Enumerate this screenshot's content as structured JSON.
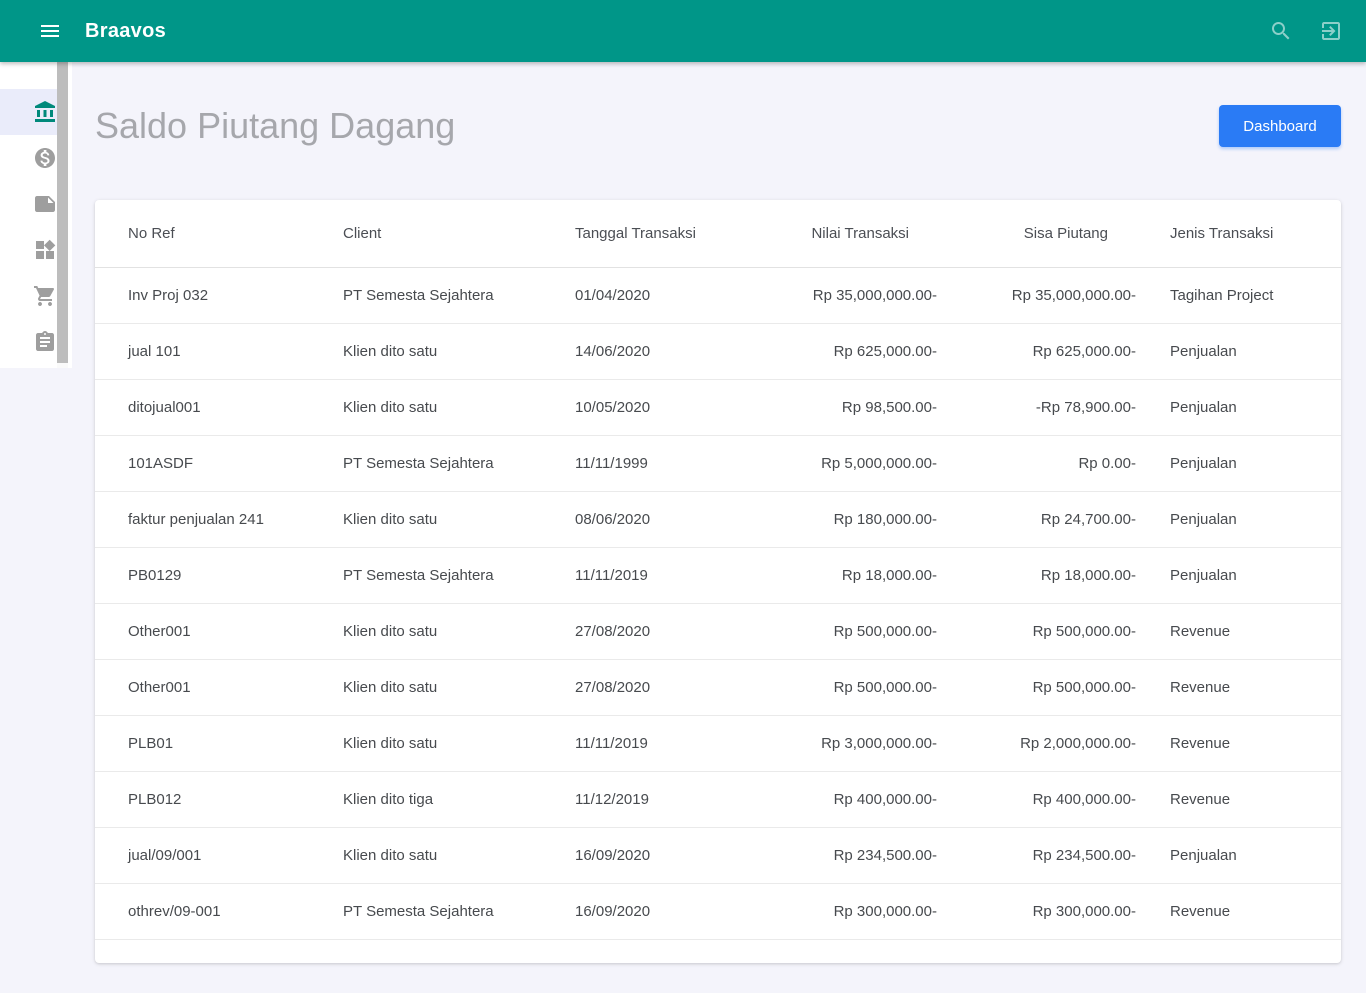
{
  "app": {
    "title": "Braavos",
    "brand_color": "#009688",
    "header_icons": [
      "menu-icon",
      "search-icon",
      "exit-icon"
    ]
  },
  "sidebar": {
    "active_icon_color": "#00897b",
    "inactive_icon_color": "#9e9e9e",
    "items": [
      {
        "icon": "bank-icon",
        "active": true
      },
      {
        "icon": "money-icon",
        "active": false
      },
      {
        "icon": "note-icon",
        "active": false
      },
      {
        "icon": "widgets-icon",
        "active": false
      },
      {
        "icon": "cart-icon",
        "active": false
      },
      {
        "icon": "clipboard-icon",
        "active": false
      }
    ]
  },
  "page": {
    "title": "Saldo Piutang Dagang",
    "dashboard_button": "Dashboard",
    "button_color": "#2a7bf5"
  },
  "table": {
    "columns": [
      "No Ref",
      "Client",
      "Tanggal Transaksi",
      "Nilai Transaksi",
      "Sisa Piutang",
      "Jenis Transaksi"
    ],
    "rows": [
      [
        "Inv Proj 032",
        "PT Semesta Sejahtera",
        "01/04/2020",
        "Rp 35,000,000.00-",
        "Rp 35,000,000.00-",
        "Tagihan Project"
      ],
      [
        "jual 101",
        "Klien dito satu",
        "14/06/2020",
        "Rp 625,000.00-",
        "Rp 625,000.00-",
        "Penjualan"
      ],
      [
        "ditojual001",
        "Klien dito satu",
        "10/05/2020",
        "Rp 98,500.00-",
        "-Rp 78,900.00-",
        "Penjualan"
      ],
      [
        "101ASDF",
        "PT Semesta Sejahtera",
        "11/11/1999",
        "Rp 5,000,000.00-",
        "Rp 0.00-",
        "Penjualan"
      ],
      [
        "faktur penjualan 241",
        "Klien dito satu",
        "08/06/2020",
        "Rp 180,000.00-",
        "Rp 24,700.00-",
        "Penjualan"
      ],
      [
        "PB0129",
        "PT Semesta Sejahtera",
        "11/11/2019",
        "Rp 18,000.00-",
        "Rp 18,000.00-",
        "Penjualan"
      ],
      [
        "Other001",
        "Klien dito satu",
        "27/08/2020",
        "Rp 500,000.00-",
        "Rp 500,000.00-",
        "Revenue"
      ],
      [
        "Other001",
        "Klien dito satu",
        "27/08/2020",
        "Rp 500,000.00-",
        "Rp 500,000.00-",
        "Revenue"
      ],
      [
        "PLB01",
        "Klien dito satu",
        "11/11/2019",
        "Rp 3,000,000.00-",
        "Rp 2,000,000.00-",
        "Revenue"
      ],
      [
        "PLB012",
        "Klien dito tiga",
        "11/12/2019",
        "Rp 400,000.00-",
        "Rp 400,000.00-",
        "Revenue"
      ],
      [
        "jual/09/001",
        "Klien dito satu",
        "16/09/2020",
        "Rp 234,500.00-",
        "Rp 234,500.00-",
        "Penjualan"
      ],
      [
        "othrev/09-001",
        "PT Semesta Sejahtera",
        "16/09/2020",
        "Rp 300,000.00-",
        "Rp 300,000.00-",
        "Revenue"
      ]
    ]
  }
}
